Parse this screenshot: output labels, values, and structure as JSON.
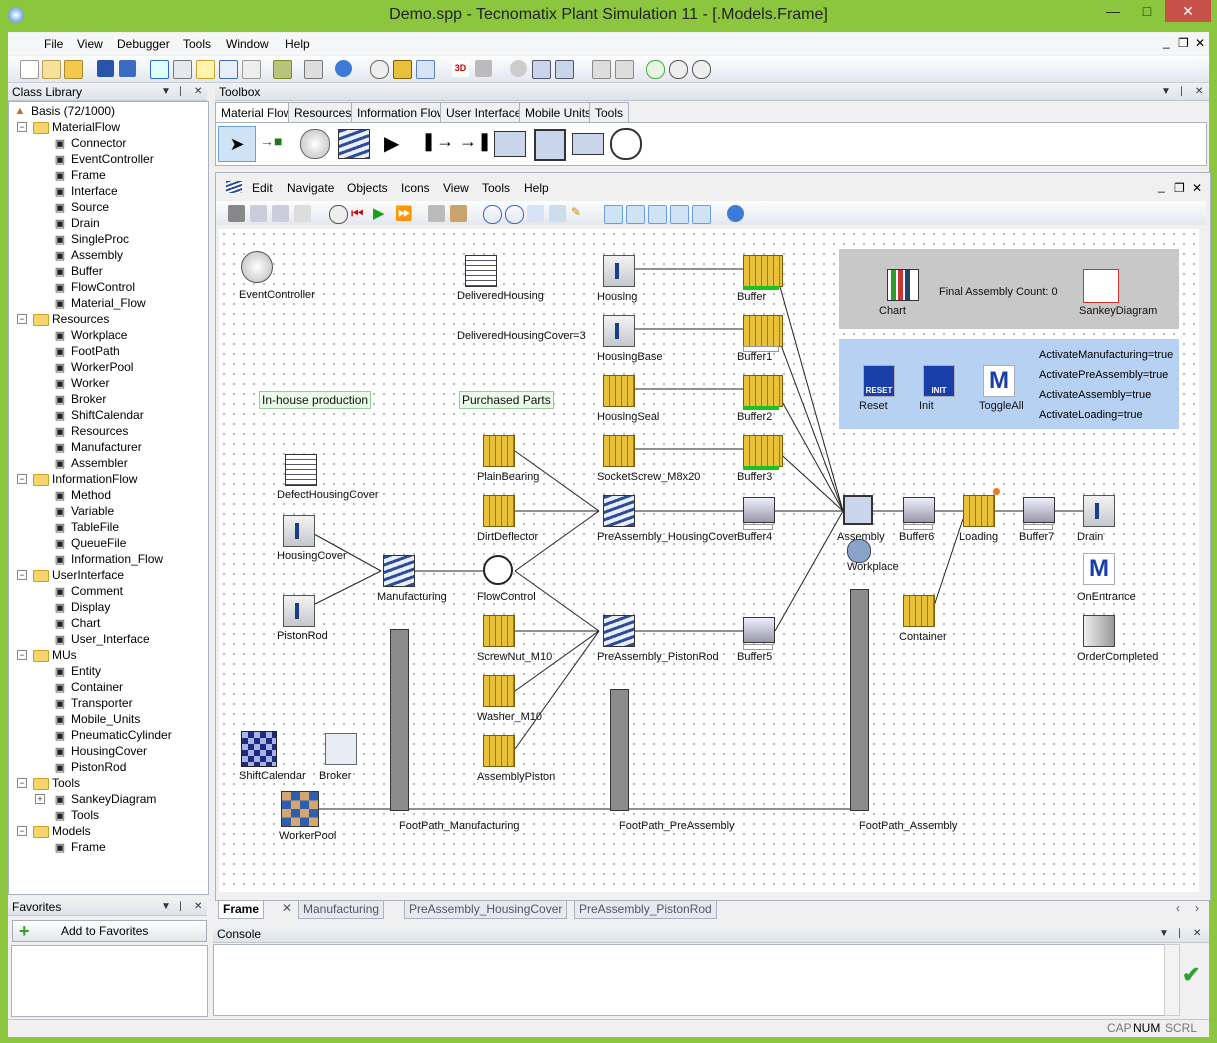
{
  "window": {
    "title": "Demo.spp - Tecnomatix Plant Simulation 11 - [.Models.Frame]"
  },
  "menu": [
    "File",
    "View",
    "Debugger",
    "Tools",
    "Window",
    "Help"
  ],
  "class_library": {
    "title": "Class Library",
    "root": "Basis (72/1000)",
    "items": [
      {
        "label": "MaterialFlow",
        "level": 1,
        "folder": true,
        "icon": "folder-icon"
      },
      {
        "label": "Connector",
        "level": 2,
        "icon": "connector-icon"
      },
      {
        "label": "EventController",
        "level": 2,
        "icon": "eventcontroller-icon"
      },
      {
        "label": "Frame",
        "level": 2,
        "icon": "frame-icon"
      },
      {
        "label": "Interface",
        "level": 2,
        "icon": "interface-icon"
      },
      {
        "label": "Source",
        "level": 2,
        "icon": "source-icon"
      },
      {
        "label": "Drain",
        "level": 2,
        "icon": "drain-icon"
      },
      {
        "label": "SingleProc",
        "level": 2,
        "icon": "singleproc-icon"
      },
      {
        "label": "Assembly",
        "level": 2,
        "icon": "assembly-icon"
      },
      {
        "label": "Buffer",
        "level": 2,
        "icon": "buffer-icon"
      },
      {
        "label": "FlowControl",
        "level": 2,
        "icon": "flowcontrol-icon"
      },
      {
        "label": "Material_Flow",
        "level": 2,
        "icon": "material-flow-icon"
      },
      {
        "label": "Resources",
        "level": 1,
        "folder": true,
        "icon": "folder-icon"
      },
      {
        "label": "Workplace",
        "level": 2,
        "icon": "workplace-icon"
      },
      {
        "label": "FootPath",
        "level": 2,
        "icon": "footpath-icon"
      },
      {
        "label": "WorkerPool",
        "level": 2,
        "icon": "workerpool-icon"
      },
      {
        "label": "Worker",
        "level": 2,
        "icon": "worker-icon"
      },
      {
        "label": "Broker",
        "level": 2,
        "icon": "broker-icon"
      },
      {
        "label": "ShiftCalendar",
        "level": 2,
        "icon": "shiftcalendar-icon"
      },
      {
        "label": "Resources",
        "level": 2,
        "icon": "resources-icon"
      },
      {
        "label": "Manufacturer",
        "level": 2,
        "icon": "manufacturer-icon"
      },
      {
        "label": "Assembler",
        "level": 2,
        "icon": "assembler-icon"
      },
      {
        "label": "InformationFlow",
        "level": 1,
        "folder": true,
        "icon": "folder-icon"
      },
      {
        "label": "Method",
        "level": 2,
        "icon": "method-icon"
      },
      {
        "label": "Variable",
        "level": 2,
        "icon": "variable-icon"
      },
      {
        "label": "TableFile",
        "level": 2,
        "icon": "tablefile-icon"
      },
      {
        "label": "QueueFile",
        "level": 2,
        "icon": "queuefile-icon"
      },
      {
        "label": "Information_Flow",
        "level": 2,
        "icon": "information-flow-icon"
      },
      {
        "label": "UserInterface",
        "level": 1,
        "folder": true,
        "icon": "folder-icon"
      },
      {
        "label": "Comment",
        "level": 2,
        "icon": "comment-icon"
      },
      {
        "label": "Display",
        "level": 2,
        "icon": "display-icon"
      },
      {
        "label": "Chart",
        "level": 2,
        "icon": "chart-icon"
      },
      {
        "label": "User_Interface",
        "level": 2,
        "icon": "user-interface-icon"
      },
      {
        "label": "MUs",
        "level": 1,
        "folder": true,
        "icon": "folder-icon"
      },
      {
        "label": "Entity",
        "level": 2,
        "icon": "entity-icon"
      },
      {
        "label": "Container",
        "level": 2,
        "icon": "container-icon"
      },
      {
        "label": "Transporter",
        "level": 2,
        "icon": "transporter-icon"
      },
      {
        "label": "Mobile_Units",
        "level": 2,
        "icon": "mobile-units-icon"
      },
      {
        "label": "PneumaticCylinder",
        "level": 2,
        "icon": "pneumaticcylinder-icon"
      },
      {
        "label": "HousingCover",
        "level": 2,
        "icon": "housingcover-icon"
      },
      {
        "label": "PistonRod",
        "level": 2,
        "icon": "pistonrod-icon"
      },
      {
        "label": "Tools",
        "level": 1,
        "folder": true,
        "icon": "folder-icon"
      },
      {
        "label": "SankeyDiagram",
        "level": 2,
        "icon": "sankeydiagram-icon",
        "expand": true
      },
      {
        "label": "Tools",
        "level": 2,
        "icon": "tools-icon"
      },
      {
        "label": "Models",
        "level": 1,
        "folder": true,
        "icon": "folder-icon"
      },
      {
        "label": "Frame",
        "level": 2,
        "icon": "frame-icon"
      }
    ]
  },
  "favorites": {
    "title": "Favorites",
    "add_label": "Add to Favorites"
  },
  "toolbox": {
    "title": "Toolbox",
    "tabs": [
      "Material Flow",
      "Resources",
      "Information Flow",
      "User Interface",
      "Mobile Units",
      "Tools"
    ]
  },
  "frame_menu": [
    "Edit",
    "Navigate",
    "Objects",
    "Icons",
    "View",
    "Tools",
    "Help"
  ],
  "canvas": {
    "objects": [
      {
        "name": "EventController",
        "label": "EventController"
      },
      {
        "name": "DeliveredHousing",
        "label": "DeliveredHousing"
      },
      {
        "name": "DeliveredHousingCover",
        "label": "DeliveredHousingCover=3"
      },
      {
        "name": "InHouse",
        "label": "In-house production"
      },
      {
        "name": "Purchased",
        "label": "Purchased Parts"
      },
      {
        "name": "DefectHousingCover",
        "label": "DefectHousingCover"
      },
      {
        "name": "HousingCover",
        "label": "HousingCover"
      },
      {
        "name": "PistonRod",
        "label": "PistonRod"
      },
      {
        "name": "Manufacturing",
        "label": "Manufacturing"
      },
      {
        "name": "PlainBearing",
        "label": "PlainBearing"
      },
      {
        "name": "DirtDeflector",
        "label": "DirtDeflector"
      },
      {
        "name": "FlowControl",
        "label": "FlowControl"
      },
      {
        "name": "ScrewNut",
        "label": "ScrewNut_M10"
      },
      {
        "name": "Washer",
        "label": "Washer_M10"
      },
      {
        "name": "AssemblyPiston",
        "label": "AssemblyPiston"
      },
      {
        "name": "Housing",
        "label": "Housing"
      },
      {
        "name": "HousingBase",
        "label": "HousingBase"
      },
      {
        "name": "HousingSeal",
        "label": "HousingSeal"
      },
      {
        "name": "SocketScrew",
        "label": "SocketScrew_M8x20"
      },
      {
        "name": "PreAssemblyHC",
        "label": "PreAssembly_HousingCover"
      },
      {
        "name": "PreAssemblyPR",
        "label": "PreAssembly_PistonRod"
      },
      {
        "name": "Buffer",
        "label": "Buffer"
      },
      {
        "name": "Buffer1",
        "label": "Buffer1"
      },
      {
        "name": "Buffer2",
        "label": "Buffer2"
      },
      {
        "name": "Buffer3",
        "label": "Buffer3"
      },
      {
        "name": "Buffer4",
        "label": "Buffer4"
      },
      {
        "name": "Buffer5",
        "label": "Buffer5"
      },
      {
        "name": "Assembly",
        "label": "Assembly"
      },
      {
        "name": "Workplace",
        "label": "Workplace"
      },
      {
        "name": "Buffer6",
        "label": "Buffer6"
      },
      {
        "name": "Loading",
        "label": "Loading"
      },
      {
        "name": "Buffer7",
        "label": "Buffer7"
      },
      {
        "name": "Drain",
        "label": "Drain"
      },
      {
        "name": "Container",
        "label": "Container"
      },
      {
        "name": "OnEntrance",
        "label": "OnEntrance"
      },
      {
        "name": "OrderCompleted",
        "label": "OrderCompleted"
      },
      {
        "name": "ShiftCalendar",
        "label": "ShiftCalendar"
      },
      {
        "name": "Broker",
        "label": "Broker"
      },
      {
        "name": "WorkerPool",
        "label": "WorkerPool"
      },
      {
        "name": "FootPathMfg",
        "label": "FootPath_Manufacturing"
      },
      {
        "name": "FootPathPre",
        "label": "FootPath_PreAssembly"
      },
      {
        "name": "FootPathAsm",
        "label": "FootPath_Assembly"
      },
      {
        "name": "Chart",
        "label": "Chart"
      },
      {
        "name": "FinalCount",
        "label": "Final Assembly Count: 0"
      },
      {
        "name": "Sankey",
        "label": "SankeyDiagram"
      },
      {
        "name": "Reset",
        "label": "Reset"
      },
      {
        "name": "Init",
        "label": "Init"
      },
      {
        "name": "ToggleAll",
        "label": "ToggleAll"
      },
      {
        "name": "ActMfg",
        "label": "ActivateManufacturing=true"
      },
      {
        "name": "ActPre",
        "label": "ActivatePreAssembly=true"
      },
      {
        "name": "ActAsm",
        "label": "ActivateAssembly=true"
      },
      {
        "name": "ActLoad",
        "label": "ActivateLoading=true"
      }
    ],
    "icon_texts": {
      "reset": "RESET",
      "init": "INIT",
      "method": "M"
    }
  },
  "bottom_tabs": [
    "Frame",
    "Manufacturing",
    "PreAssembly_HousingCover",
    "PreAssembly_PistonRod"
  ],
  "console": {
    "title": "Console"
  },
  "status": [
    "CAP",
    "NUM",
    "SCRL"
  ],
  "colors": {
    "frame": "#8cc63f",
    "close": "#c7504b",
    "panel_gray": "#c8c8c8",
    "panel_blue": "#b7d1f2"
  }
}
